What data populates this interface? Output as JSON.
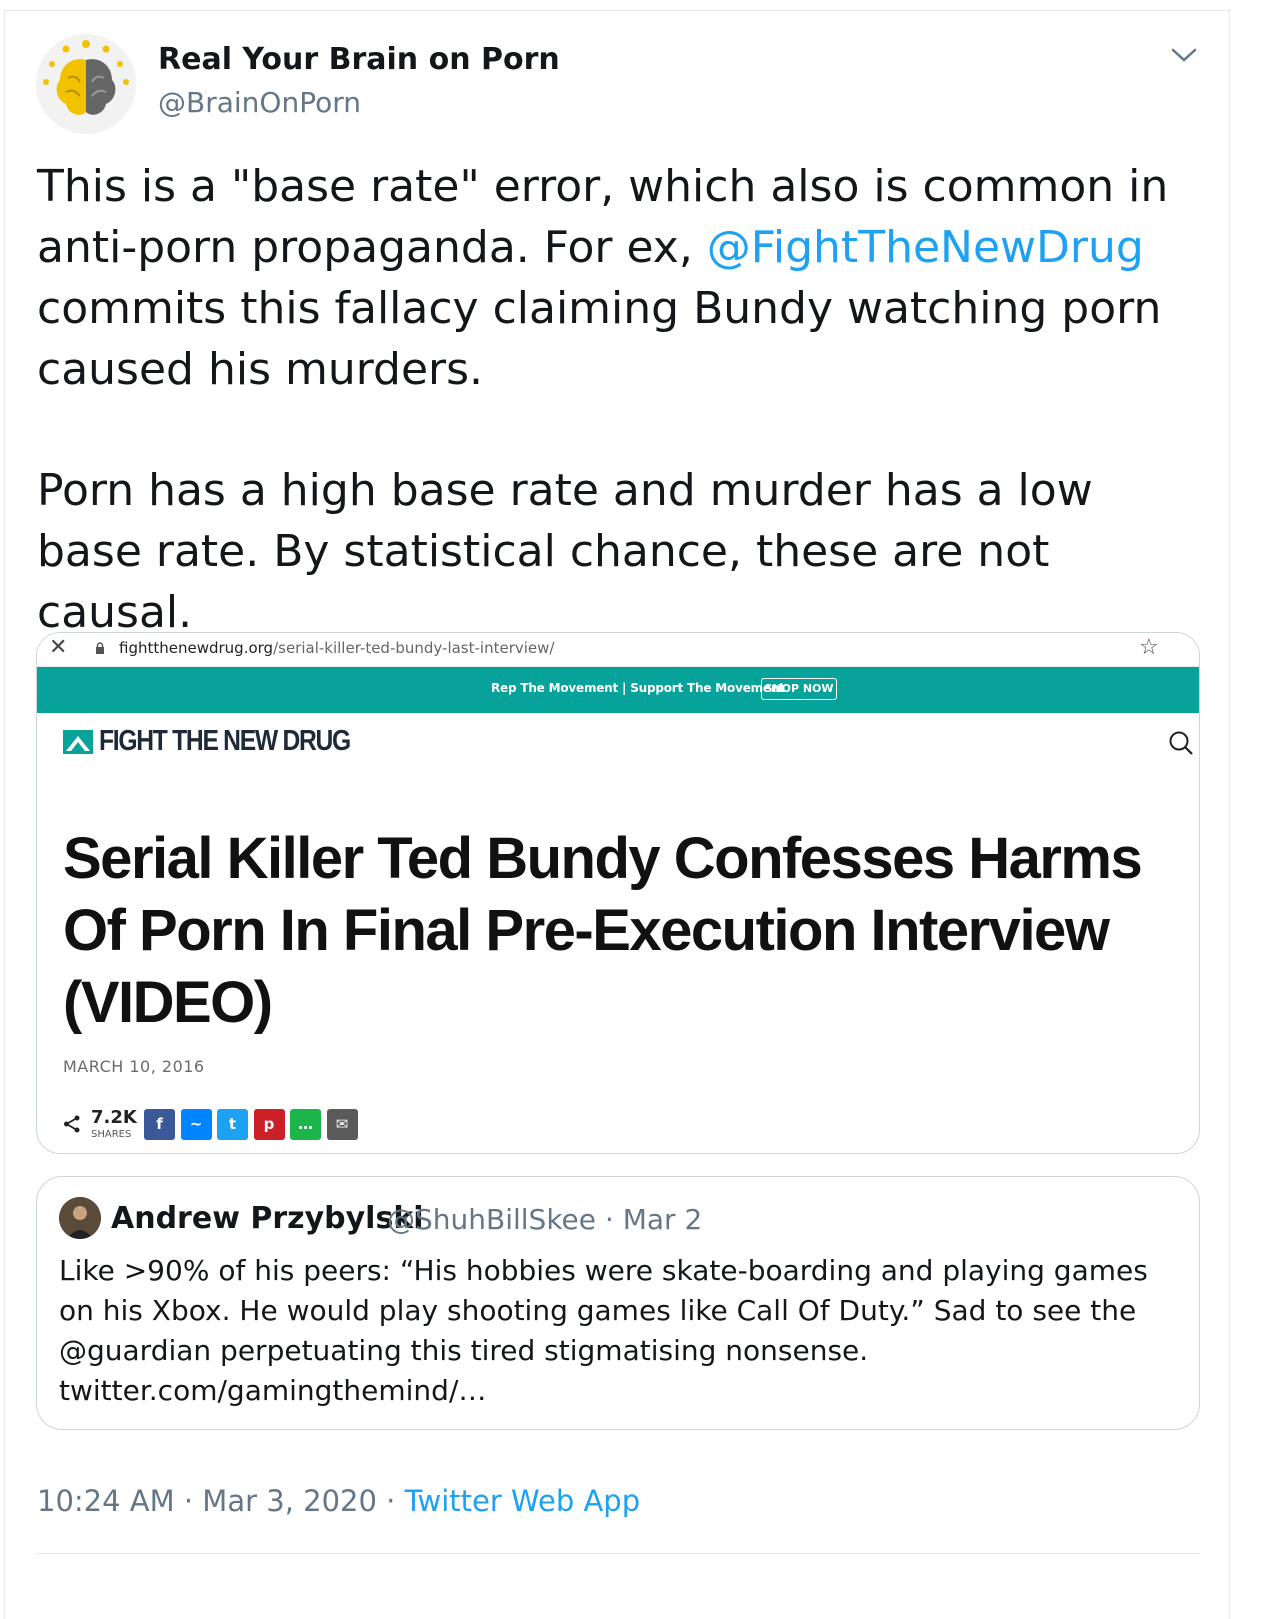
{
  "author": {
    "name": "Real Your Brain on Porn",
    "handle": "@BrainOnPorn"
  },
  "tweet": {
    "text_part1": "This is a \"base rate\" error, which also is common in anti-porn propaganda. For ex, ",
    "mention": "@FightTheNewDrug",
    "text_part2": " commits this fallacy claiming Bundy watching porn caused his murders.",
    "paragraph2": "Porn has a high base rate and murder has a low base rate. By statistical chance, these are not causal."
  },
  "media": {
    "url_domain": "fightthenewdrug.org",
    "url_path": "/serial-killer-ted-bundy-last-interview/",
    "promo_text": "Rep The Movement | Support The Movement",
    "shop_label": "SHOP NOW",
    "logo_text": "FIGHT THE NEW DRUG",
    "headline": "Serial Killer Ted Bundy Confesses Harms\nOf Porn In Final Pre-Execution Interview\n(VIDEO)",
    "date": "MARCH 10, 2016",
    "share_count": "7.2K",
    "share_label": "SHARES",
    "social": [
      {
        "name": "facebook",
        "glyph": "f",
        "color": "#3b5998"
      },
      {
        "name": "messenger",
        "glyph": "~",
        "color": "#0084ff"
      },
      {
        "name": "twitter",
        "glyph": "t",
        "color": "#1da1f2"
      },
      {
        "name": "pinterest",
        "glyph": "p",
        "color": "#cb2027"
      },
      {
        "name": "sms",
        "glyph": "…",
        "color": "#1cb54a"
      },
      {
        "name": "email",
        "glyph": "✉",
        "color": "#5a5a5a"
      }
    ]
  },
  "quote": {
    "name": "Andrew Przybylski",
    "handle": "@ShuhBillSkee",
    "date": "· Mar 2",
    "text": "Like >90% of his peers: “His hobbies were skate-boarding and playing games on his Xbox. He would play shooting games like Call Of Duty.” Sad to see the @guardian perpetuating this tired stigmatising nonsense. twitter.com/gamingthemind/…"
  },
  "footer": {
    "time": "10:24 AM · Mar 3, 2020 · ",
    "app": "Twitter Web App"
  },
  "colors": {
    "accent": "#1da1f2",
    "promo": "#07a39a",
    "secondary_text": "#657786"
  }
}
